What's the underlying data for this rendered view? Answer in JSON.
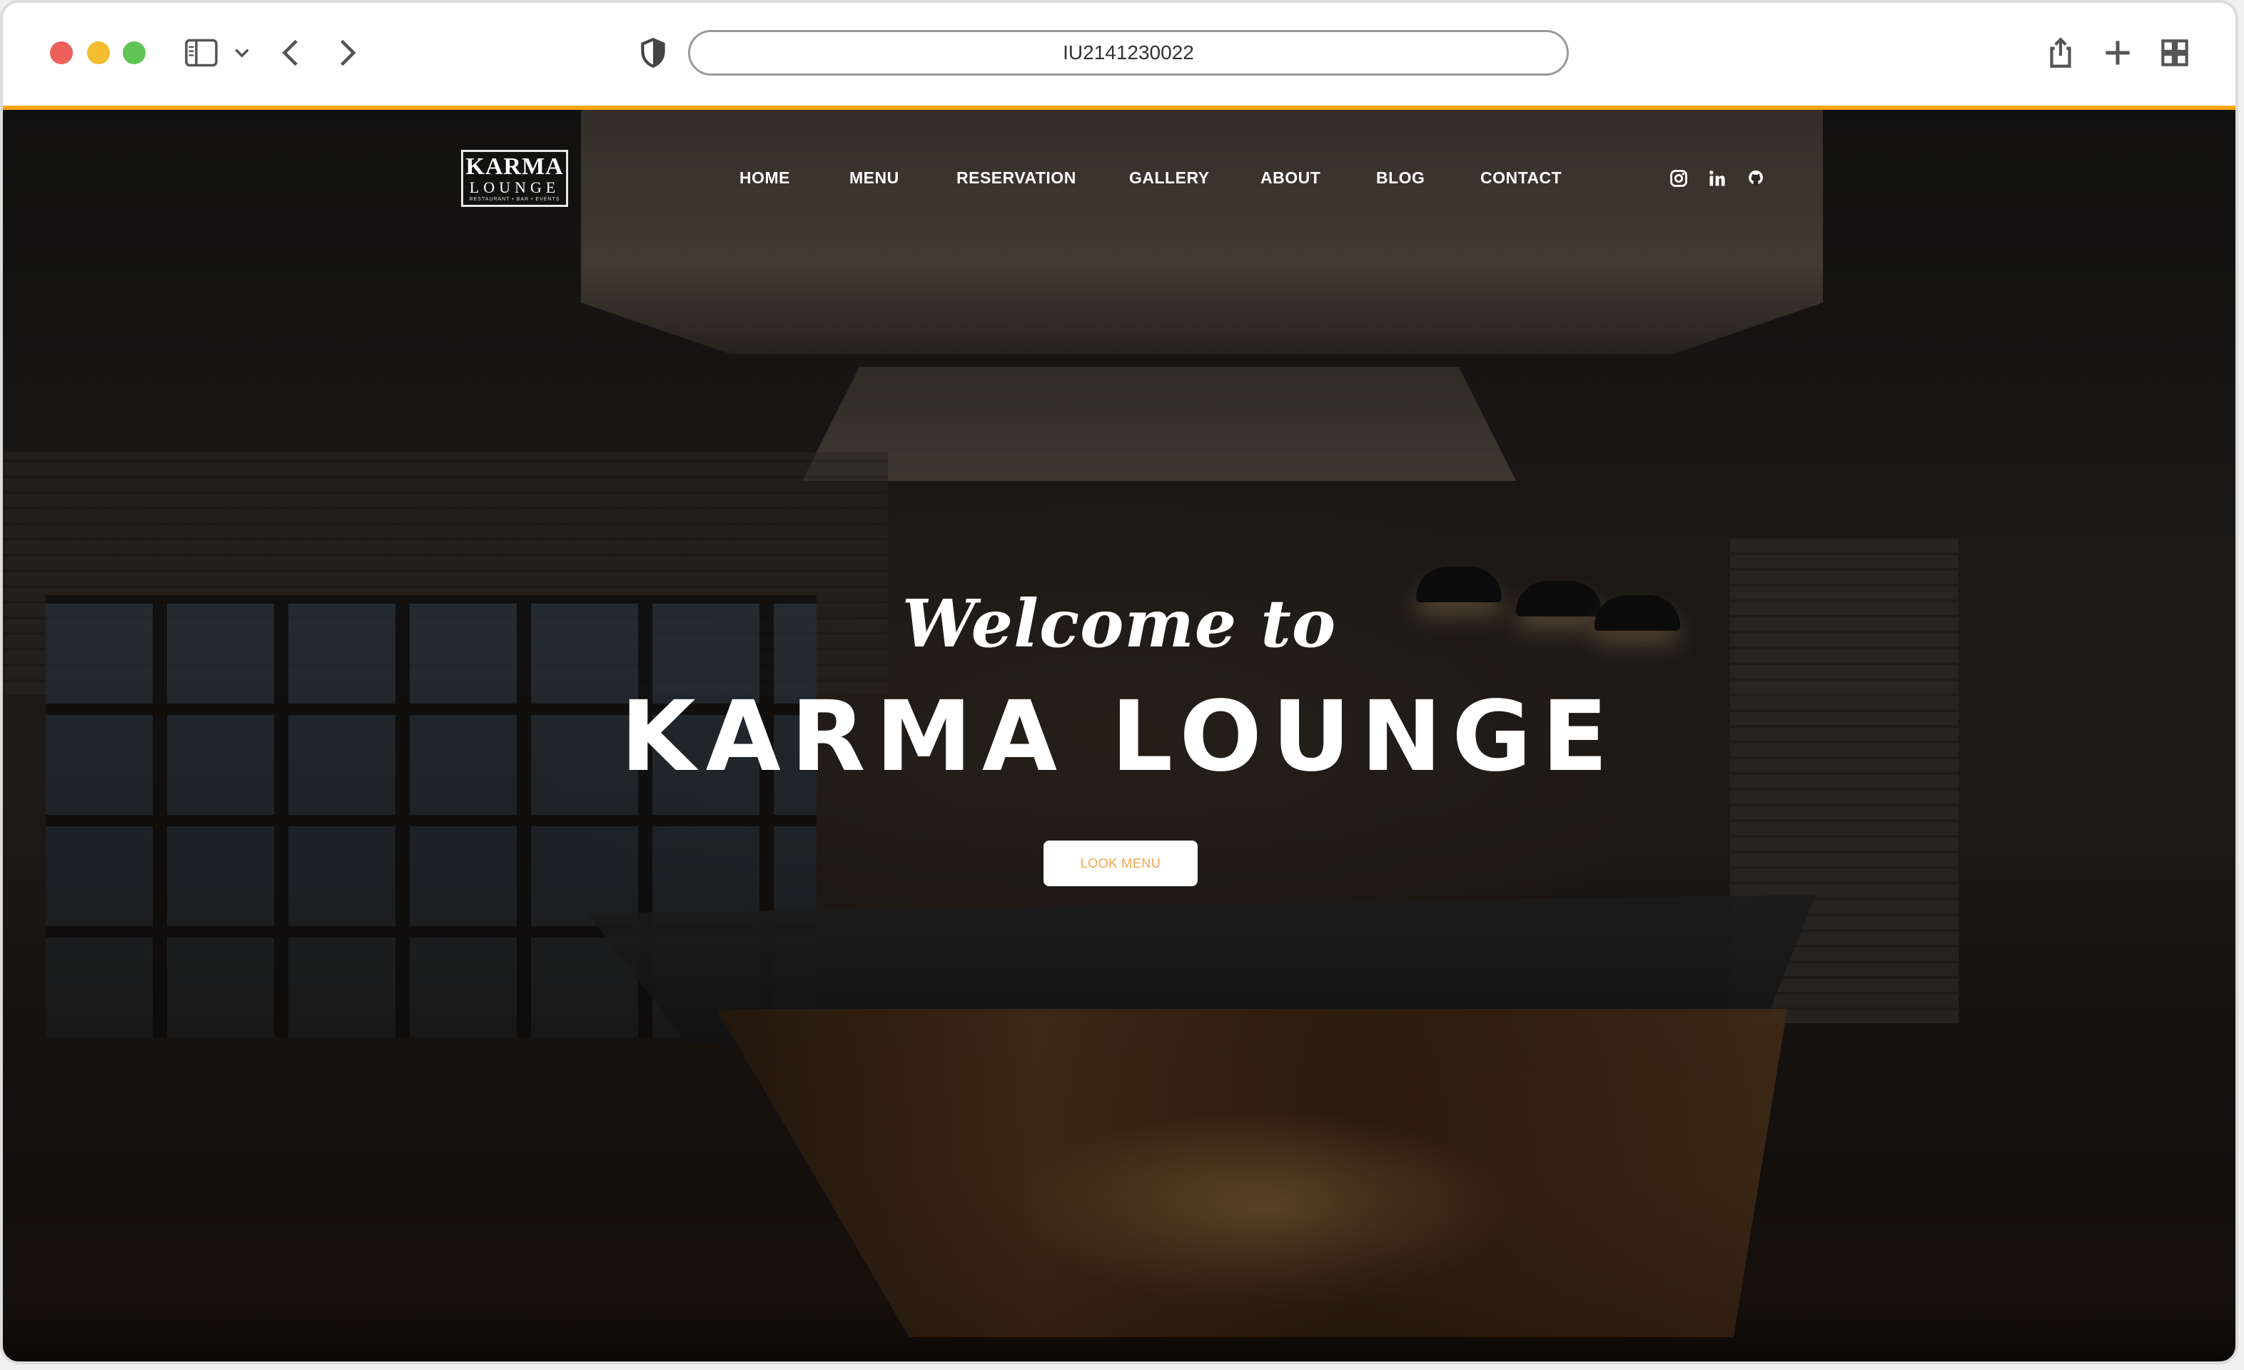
{
  "browser": {
    "url": "IU2141230022",
    "icons": [
      "sidebar-icon",
      "chevron-down-icon",
      "back-icon",
      "forward-icon",
      "shield-icon",
      "share-icon",
      "new-tab-icon",
      "tab-overview-icon"
    ],
    "accent_color": "#f2a516"
  },
  "site": {
    "logo": {
      "top": "KARMA",
      "bottom": "LOUNGE",
      "tagline": "RESTAURANT • BAR • EVENTS"
    },
    "nav": [
      "HOME",
      "MENU",
      "RESERVATION",
      "GALLERY",
      "ABOUT",
      "BLOG",
      "CONTACT"
    ],
    "social": [
      "instagram-icon",
      "linkedin-icon",
      "github-icon"
    ]
  },
  "hero": {
    "welcome": "Welcome to",
    "title": "KARMA LOUNGE",
    "button": "LOOK MENU",
    "button_text_color": "#f2a54a"
  }
}
